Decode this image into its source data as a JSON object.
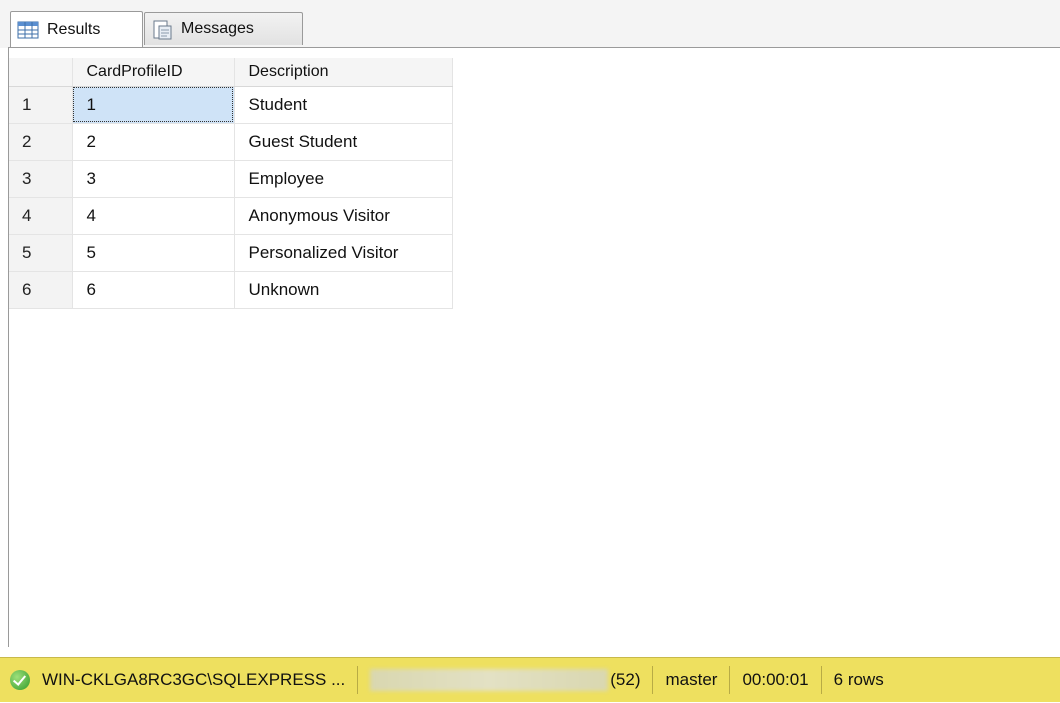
{
  "tabs": [
    {
      "label": "Results",
      "icon": "grid-icon"
    },
    {
      "label": "Messages",
      "icon": "document-icon"
    }
  ],
  "grid": {
    "columns": [
      "CardProfileID",
      "Description"
    ],
    "rows": [
      {
        "num": "1",
        "id": "1",
        "desc": "Student"
      },
      {
        "num": "2",
        "id": "2",
        "desc": "Guest Student"
      },
      {
        "num": "3",
        "id": "3",
        "desc": "Employee"
      },
      {
        "num": "4",
        "id": "4",
        "desc": "Anonymous Visitor"
      },
      {
        "num": "5",
        "id": "5",
        "desc": "Personalized Visitor"
      },
      {
        "num": "6",
        "id": "6",
        "desc": "Unknown"
      }
    ]
  },
  "status": {
    "server": "WIN-CKLGA8RC3GC\\SQLEXPRESS ...",
    "spid": "(52)",
    "database": "master",
    "elapsed": "00:00:01",
    "rows": "6 rows",
    "bar_color": "#eee05f"
  }
}
